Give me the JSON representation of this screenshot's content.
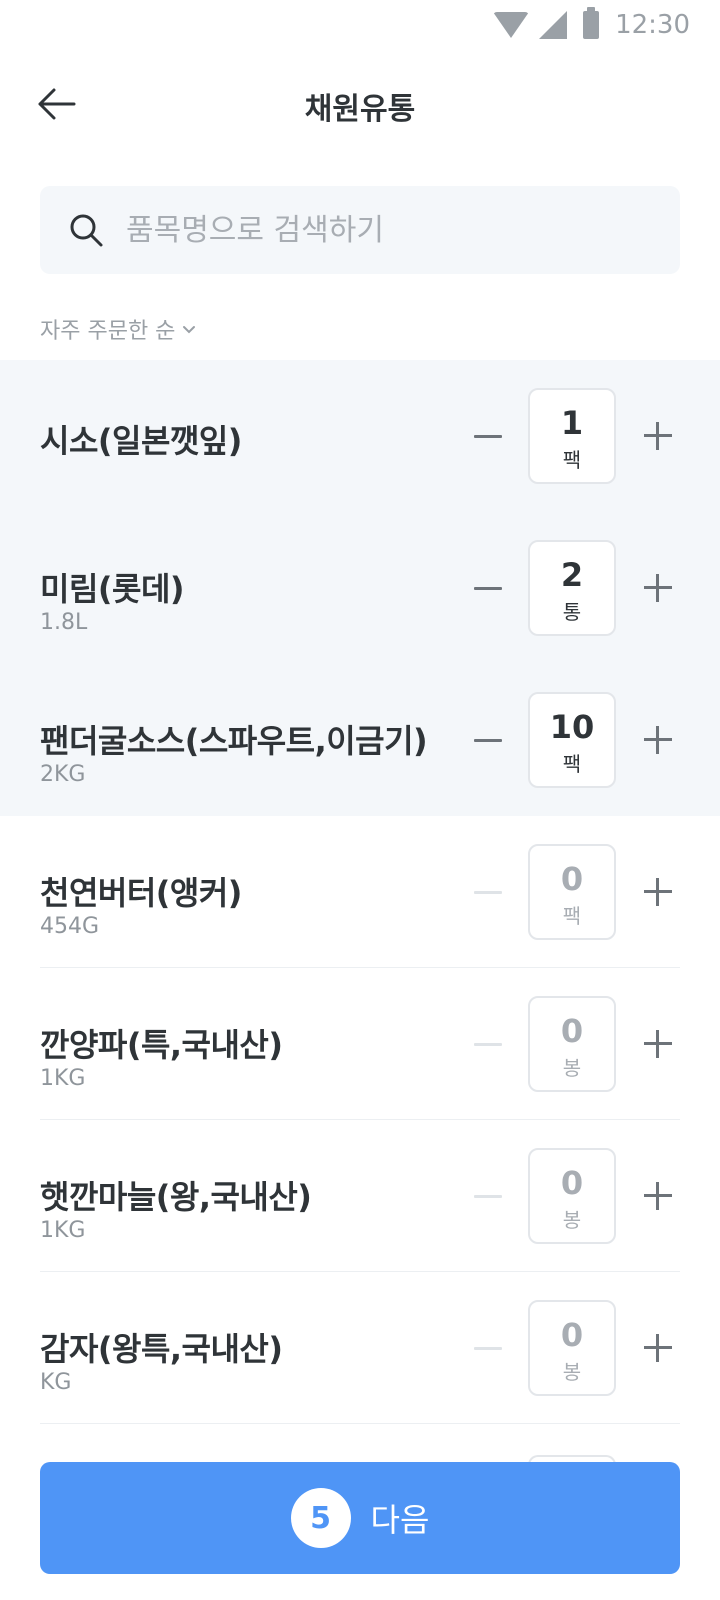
{
  "status_bar": {
    "time": "12:30",
    "icons": [
      "wifi-icon",
      "signal-icon",
      "battery-icon"
    ]
  },
  "header": {
    "title": "채원유통",
    "back_icon": "back-arrow-icon"
  },
  "search": {
    "placeholder": "품목명으로 검색하기",
    "value": ""
  },
  "sort": {
    "label": "자주 주문한 순"
  },
  "items": [
    {
      "name": "시소(일본깻잎)",
      "sub": "",
      "qty": "1",
      "unit": "팩"
    },
    {
      "name": "미림(롯데)",
      "sub": "1.8L",
      "qty": "2",
      "unit": "통"
    },
    {
      "name": "팬더굴소스(스파우트,이금기)",
      "sub": "2KG",
      "qty": "10",
      "unit": "팩"
    },
    {
      "name": "천연버터(앵커)",
      "sub": "454G",
      "qty": "0",
      "unit": "팩"
    },
    {
      "name": "깐양파(특,국내산)",
      "sub": "1KG",
      "qty": "0",
      "unit": "봉"
    },
    {
      "name": "햇깐마늘(왕,국내산)",
      "sub": "1KG",
      "qty": "0",
      "unit": "봉"
    },
    {
      "name": "감자(왕특,국내산)",
      "sub": "KG",
      "qty": "0",
      "unit": "봉"
    }
  ],
  "next_button": {
    "count": "5",
    "label": "다음",
    "color": "#4f95f6"
  },
  "colors": {
    "selected_bg": "#f4f7fa",
    "text": "#2f3438",
    "muted": "#9aa0a6"
  }
}
